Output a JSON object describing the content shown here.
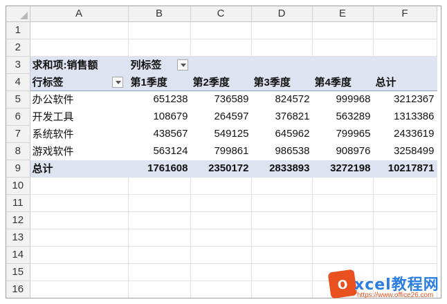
{
  "columns": [
    "A",
    "B",
    "C",
    "D",
    "E",
    "F"
  ],
  "rows": [
    "1",
    "2",
    "3",
    "4",
    "5",
    "6",
    "7",
    "8",
    "9",
    "10",
    "11",
    "12",
    "13",
    "14",
    "15",
    "16"
  ],
  "pivot": {
    "value_field_label": "求和项:销售额",
    "column_labels_caption": "列标签",
    "row_labels_caption": "行标签",
    "column_headers": [
      "第1季度",
      "第2季度",
      "第3季度",
      "第4季度",
      "总计"
    ],
    "data_rows": [
      {
        "label": "办公软件",
        "values": [
          "651238",
          "736589",
          "824572",
          "999968",
          "3212367"
        ]
      },
      {
        "label": "开发工具",
        "values": [
          "108679",
          "264597",
          "376821",
          "563289",
          "1313386"
        ]
      },
      {
        "label": "系统软件",
        "values": [
          "438567",
          "549125",
          "645962",
          "799965",
          "2433619"
        ]
      },
      {
        "label": "游戏软件",
        "values": [
          "563124",
          "799861",
          "986538",
          "908976",
          "3258499"
        ]
      }
    ],
    "total_row": {
      "label": "总计",
      "values": [
        "1761608",
        "2350172",
        "2833893",
        "3272198",
        "10217871"
      ]
    }
  },
  "watermark": {
    "logo_letter": "o",
    "title": "xcel教程网",
    "url": "https://www.office26.com"
  }
}
